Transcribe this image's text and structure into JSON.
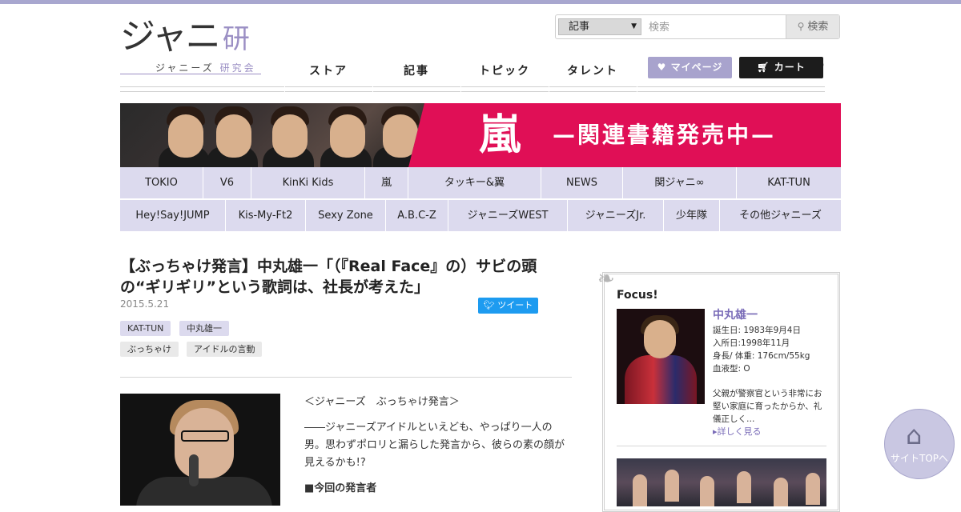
{
  "logo": {
    "main": "ジャニ",
    "ken": "研",
    "sub_a": "ジャニーズ",
    "sub_b": "研究会"
  },
  "search": {
    "category": "記事",
    "placeholder": "検索",
    "button": "検索"
  },
  "nav": {
    "items": [
      "ストア",
      "記事",
      "トピック",
      "タレント"
    ]
  },
  "account": {
    "mypage": "マイページ",
    "cart": "カート"
  },
  "banner": {
    "big": "嵐",
    "text": "—関連書籍発売中—"
  },
  "groups": {
    "row1": [
      "TOKIO",
      "V6",
      "KinKi Kids",
      "嵐",
      "タッキー&翼",
      "NEWS",
      "関ジャニ∞",
      "KAT-TUN"
    ],
    "row2": [
      "Hey!Say!JUMP",
      "Kis-My-Ft2",
      "Sexy Zone",
      "A.B.C-Z",
      "ジャニーズWEST",
      "ジャニーズJr.",
      "少年隊",
      "その他ジャニーズ"
    ]
  },
  "article": {
    "title": "【ぶっちゃけ発言】中丸雄一「（『Real Face』の）サビの頭の“ギリギリ”という歌詞は、社長が考えた」",
    "date": "2015.5.21",
    "tweet": "ツイート",
    "tags_purple": [
      "KAT-TUN",
      "中丸雄一"
    ],
    "tags_gray": [
      "ぶっちゃけ",
      "アイドルの言動"
    ],
    "body": {
      "p1": "＜ジャニーズ　ぶっちゃけ発言＞",
      "p2": "――ジャニーズアイドルといえども、やっぱり一人の男。思わずポロリと漏らした発言から、彼らの素の顔が見えるかも!?",
      "p3": "■今回の発言者"
    }
  },
  "sidebar": {
    "heading": "Focus!",
    "name": "中丸雄一",
    "info": [
      "誕生日: 1983年9月4日",
      "入所日:1998年11月",
      "身長/ 体重: 176cm/55kg",
      "血液型: O"
    ],
    "desc": "父親が警察官という非常にお堅い家庭に育ったからか、礼儀正しく…",
    "more": "詳しく見る"
  },
  "to_top": {
    "label": "サイトTOPへ"
  },
  "colors": {
    "accent_purple": "#a8a3cd",
    "banner_pink": "#e00f56",
    "group_bg": "#dcdaee",
    "twitter": "#1d9bf0"
  }
}
